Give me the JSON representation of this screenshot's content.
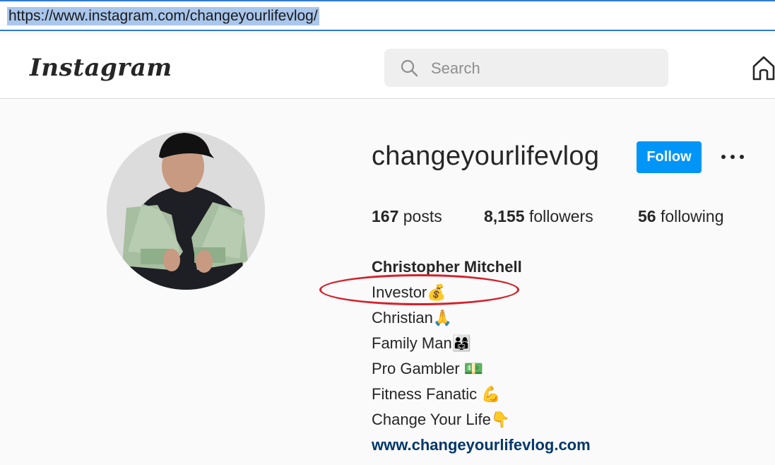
{
  "browser": {
    "url": "https://www.instagram.com/changeyourlifevlog/"
  },
  "nav": {
    "logo": "Instagram",
    "search_placeholder": "Search",
    "icons": [
      "search-icon",
      "home-icon"
    ]
  },
  "profile": {
    "username": "changeyourlifevlog",
    "follow_label": "Follow",
    "stats": [
      {
        "count": "167",
        "label": "posts"
      },
      {
        "count": "8,155",
        "label": "followers"
      },
      {
        "count": "56",
        "label": "following"
      }
    ],
    "full_name": "Christopher Mitchell",
    "bio_lines": [
      "Investor💰",
      "Christian🙏",
      "Family Man👨‍👩‍👧",
      "Pro Gambler 💵",
      "Fitness Fanatic 💪",
      "Change Your Life👇"
    ],
    "website": "www.changeyourlifevlog.com"
  },
  "colors": {
    "follow_button": "#0095f6",
    "link": "#00376b",
    "annotation_circle": "#d4212c",
    "url_selection": "#a9c6ec"
  }
}
